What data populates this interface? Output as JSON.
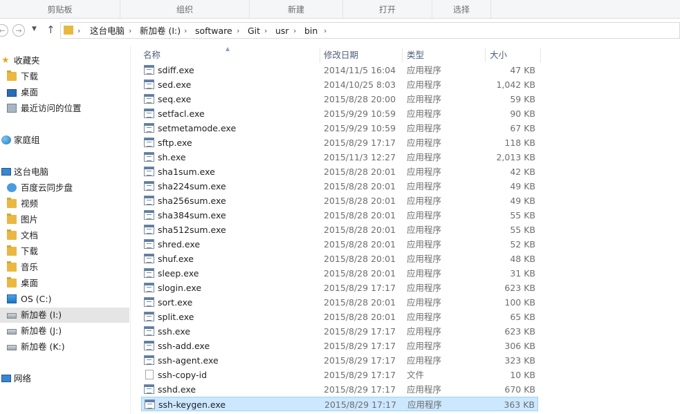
{
  "ribbon": {
    "groups": [
      "剪贴板",
      "组织",
      "新建",
      "打开",
      "选择"
    ]
  },
  "nav": {
    "breadcrumbs": [
      "这台电脑",
      "新加卷 (I:)",
      "software",
      "Git",
      "usr",
      "bin"
    ]
  },
  "sidebar": {
    "favorites": "收藏夹",
    "fav_items": [
      "下载",
      "桌面",
      "最近访问的位置"
    ],
    "homegroup": "家庭组",
    "thispc": "这台电脑",
    "pc_items": [
      "百度云同步盘",
      "视频",
      "图片",
      "文档",
      "下载",
      "音乐",
      "桌面",
      "OS (C:)",
      "新加卷 (I:)",
      "新加卷 (J:)",
      "新加卷 (K:)"
    ],
    "network": "网络"
  },
  "columns": {
    "name": "名称",
    "date": "修改日期",
    "type": "类型",
    "size": "大小"
  },
  "files": [
    {
      "name": "sdiff.exe",
      "date": "2014/11/5 16:04",
      "type": "应用程序",
      "size": "47 KB"
    },
    {
      "name": "sed.exe",
      "date": "2014/10/25 8:03",
      "type": "应用程序",
      "size": "1,042 KB"
    },
    {
      "name": "seq.exe",
      "date": "2015/8/28 20:00",
      "type": "应用程序",
      "size": "59 KB"
    },
    {
      "name": "setfacl.exe",
      "date": "2015/9/29 10:59",
      "type": "应用程序",
      "size": "90 KB"
    },
    {
      "name": "setmetamode.exe",
      "date": "2015/9/29 10:59",
      "type": "应用程序",
      "size": "67 KB"
    },
    {
      "name": "sftp.exe",
      "date": "2015/8/29 17:17",
      "type": "应用程序",
      "size": "118 KB"
    },
    {
      "name": "sh.exe",
      "date": "2015/11/3 12:27",
      "type": "应用程序",
      "size": "2,013 KB"
    },
    {
      "name": "sha1sum.exe",
      "date": "2015/8/28 20:01",
      "type": "应用程序",
      "size": "42 KB"
    },
    {
      "name": "sha224sum.exe",
      "date": "2015/8/28 20:01",
      "type": "应用程序",
      "size": "49 KB"
    },
    {
      "name": "sha256sum.exe",
      "date": "2015/8/28 20:01",
      "type": "应用程序",
      "size": "49 KB"
    },
    {
      "name": "sha384sum.exe",
      "date": "2015/8/28 20:01",
      "type": "应用程序",
      "size": "55 KB"
    },
    {
      "name": "sha512sum.exe",
      "date": "2015/8/28 20:01",
      "type": "应用程序",
      "size": "55 KB"
    },
    {
      "name": "shred.exe",
      "date": "2015/8/28 20:01",
      "type": "应用程序",
      "size": "52 KB"
    },
    {
      "name": "shuf.exe",
      "date": "2015/8/28 20:01",
      "type": "应用程序",
      "size": "48 KB"
    },
    {
      "name": "sleep.exe",
      "date": "2015/8/28 20:01",
      "type": "应用程序",
      "size": "31 KB"
    },
    {
      "name": "slogin.exe",
      "date": "2015/8/29 17:17",
      "type": "应用程序",
      "size": "623 KB"
    },
    {
      "name": "sort.exe",
      "date": "2015/8/28 20:01",
      "type": "应用程序",
      "size": "100 KB"
    },
    {
      "name": "split.exe",
      "date": "2015/8/28 20:01",
      "type": "应用程序",
      "size": "65 KB"
    },
    {
      "name": "ssh.exe",
      "date": "2015/8/29 17:17",
      "type": "应用程序",
      "size": "623 KB"
    },
    {
      "name": "ssh-add.exe",
      "date": "2015/8/29 17:17",
      "type": "应用程序",
      "size": "306 KB"
    },
    {
      "name": "ssh-agent.exe",
      "date": "2015/8/29 17:17",
      "type": "应用程序",
      "size": "323 KB"
    },
    {
      "name": "ssh-copy-id",
      "date": "2015/8/29 17:17",
      "type": "文件",
      "size": "10 KB"
    },
    {
      "name": "sshd.exe",
      "date": "2015/8/29 17:17",
      "type": "应用程序",
      "size": "670 KB"
    },
    {
      "name": "ssh-keygen.exe",
      "date": "2015/8/29 17:17",
      "type": "应用程序",
      "size": "363 KB"
    }
  ],
  "colors": {
    "selection_bg": "#cce8ff",
    "selection_border": "#99d1ff",
    "header_text": "#4c607a",
    "folder": "#e9b843"
  }
}
